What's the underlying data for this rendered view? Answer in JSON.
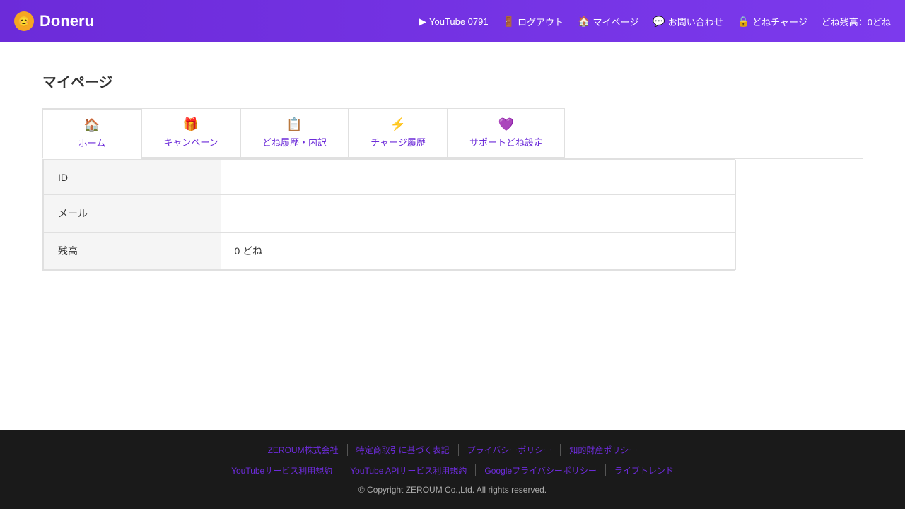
{
  "header": {
    "logo_text": "Doneru",
    "logo_icon": "D",
    "nav": [
      {
        "id": "youtube",
        "icon": "▶",
        "label": "YouTube 0791"
      },
      {
        "id": "logout",
        "icon": "🚪",
        "label": "ログアウト"
      },
      {
        "id": "mypage",
        "icon": "🏠",
        "label": "マイページ"
      },
      {
        "id": "contact",
        "icon": "💬",
        "label": "お問い合わせ"
      },
      {
        "id": "charge",
        "icon": "🔒",
        "label": "どねチャージ"
      },
      {
        "id": "balance",
        "icon": "",
        "label": "どね残高：0どね"
      }
    ]
  },
  "page": {
    "title": "マイページ"
  },
  "tabs": [
    {
      "id": "home",
      "icon": "🏠",
      "label": "ホーム",
      "active": true
    },
    {
      "id": "campaign",
      "icon": "🎁",
      "label": "キャンペーン",
      "active": false
    },
    {
      "id": "history",
      "icon": "📋",
      "label": "どね履歴・内訳",
      "active": false
    },
    {
      "id": "charge-history",
      "icon": "⚡",
      "label": "チャージ履歴",
      "active": false
    },
    {
      "id": "support",
      "icon": "💜",
      "label": "サポートどね設定",
      "active": false
    }
  ],
  "user_info": [
    {
      "label": "ID",
      "value": ""
    },
    {
      "label": "メール",
      "value": ""
    },
    {
      "label": "残高",
      "value": "0 どね"
    }
  ],
  "footer": {
    "links_row1": [
      "ZEROUM株式会社",
      "特定商取引に基づく表記",
      "プライバシーポリシー",
      "知的財産ポリシー"
    ],
    "links_row2": [
      "YouTubeサービス利用規約",
      "YouTube APIサービス利用規約",
      "Googleプライバシーポリシー",
      "ライブトレンド"
    ],
    "copyright": "© Copyright ZEROUM Co.,Ltd. All rights reserved."
  }
}
